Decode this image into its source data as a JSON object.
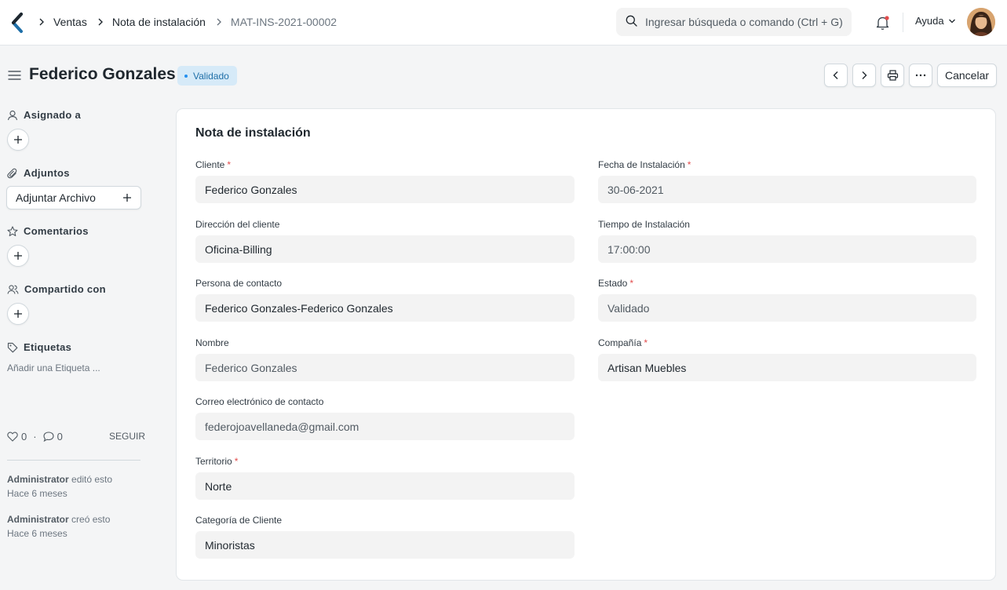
{
  "breadcrumb": {
    "items": [
      "Ventas",
      "Nota de instalación"
    ],
    "current": "MAT-INS-2021-00002"
  },
  "search": {
    "placeholder": "Ingresar búsqueda o comando (Ctrl + G)"
  },
  "navbar": {
    "help_label": "Ayuda"
  },
  "page": {
    "title": "Federico Gonzales",
    "status": "Validado",
    "cancel_label": "Cancelar"
  },
  "sidebar": {
    "assigned_to": "Asignado a",
    "attachments": "Adjuntos",
    "attach_file": "Adjuntar Archivo",
    "comments": "Comentarios",
    "shared_with": "Compartido con",
    "tags": "Etiquetas",
    "add_tag": "Añadir una Etiqueta ...",
    "likes": "0",
    "comment_count": "0",
    "separator": "·",
    "follow": "SEGUIR",
    "activity": [
      {
        "user": "Administrator",
        "action": "editó esto",
        "time": "Hace 6 meses"
      },
      {
        "user": "Administrator",
        "action": "creó esto",
        "time": "Hace 6 meses"
      }
    ]
  },
  "form": {
    "title": "Nota de instalación",
    "left": [
      {
        "label": "Cliente",
        "required": "*",
        "value": "Federico Gonzales"
      },
      {
        "label": "Dirección del cliente",
        "value": "Oficina-Billing"
      },
      {
        "label": "Persona de contacto",
        "value": "Federico Gonzales-Federico Gonzales"
      },
      {
        "label": "Nombre",
        "value": "Federico Gonzales"
      },
      {
        "label": "Correo electrónico de contacto",
        "value": "federojoavellaneda@gmail.com"
      },
      {
        "label": "Territorio",
        "required": "*",
        "value": "Norte"
      },
      {
        "label": "Categoría de Cliente",
        "value": "Minoristas"
      }
    ],
    "right": [
      {
        "label": "Fecha de Instalación",
        "required": "*",
        "value": "30-06-2021"
      },
      {
        "label": "Tiempo de Instalación",
        "value": "17:00:00"
      },
      {
        "label": "Estado",
        "required": "*",
        "value": "Validado"
      },
      {
        "label": "Compañía",
        "required": "*",
        "value": "Artisan Muebles"
      }
    ]
  },
  "colors": {
    "accent": "#2490ef",
    "badge_bg": "#d6eaf8",
    "required": "#e24c4c"
  }
}
